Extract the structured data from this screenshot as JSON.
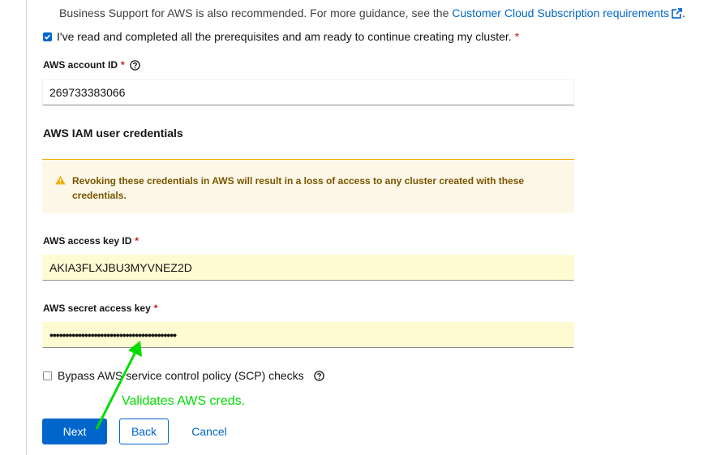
{
  "prerequisites": {
    "text_prefix": "Business Support for AWS is also recommended. For more guidance, see the ",
    "link_label": "Customer Cloud Subscription requirements",
    "trailing": ".",
    "confirm_label": "I've read and completed all the prerequisites and am ready to continue creating my cluster.",
    "confirm_checked": true
  },
  "required_marker": "*",
  "account_id": {
    "label": "AWS account ID",
    "value": "269733383066"
  },
  "credentials": {
    "section_title": "AWS IAM user credentials",
    "alert_text": "Revoking these credentials in AWS will result in a loss of access to any cluster created with these credentials.",
    "access_key": {
      "label": "AWS access key ID",
      "value": "AKIA3FLXJBU3MYVNEZ2D"
    },
    "secret_key": {
      "label": "AWS secret access key",
      "masked_value": "••••••••••••••••••••••••••••••••••••••••"
    }
  },
  "bypass": {
    "label": "Bypass AWS service control policy (SCP) checks",
    "checked": false
  },
  "annotation": "Validates AWS creds.",
  "buttons": {
    "next": "Next",
    "back": "Back",
    "cancel": "Cancel"
  },
  "colors": {
    "link": "#0066cc",
    "primary": "#0066cc",
    "required": "#c9190b",
    "warning": "#f0ab00",
    "autofill": "#fefbd3",
    "annotation": "#00dd00"
  }
}
